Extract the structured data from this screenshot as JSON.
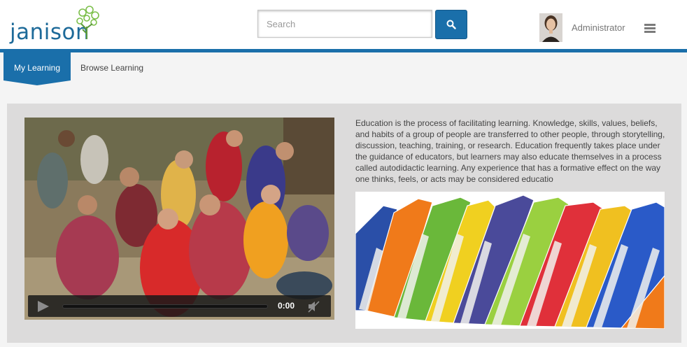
{
  "header": {
    "logo_text": "janison",
    "search_placeholder": "Search",
    "user_name": "Administrator"
  },
  "tabs": [
    {
      "label": "My Learning",
      "active": true
    },
    {
      "label": "Browse Learning",
      "active": false
    }
  ],
  "video": {
    "time": "0:00"
  },
  "description": "Education is the process of facilitating learning. Knowledge, skills, values, beliefs, and habits of a group of people are transferred to other people, through storytelling, discussion, teaching, training, or research. Education frequently takes place under the guidance of educators, but learners may also educate themselves in a process called autodidactic learning. Any experience that has a formative effect on the way one thinks, feels, or acts may be considered educatio",
  "colors": {
    "brand_blue": "#1a6faa",
    "panel_bg": "#dcdbdb",
    "page_bg": "#f4f4f4"
  },
  "icons": [
    "search-icon",
    "hamburger-menu-icon",
    "play-icon",
    "mute-icon"
  ]
}
